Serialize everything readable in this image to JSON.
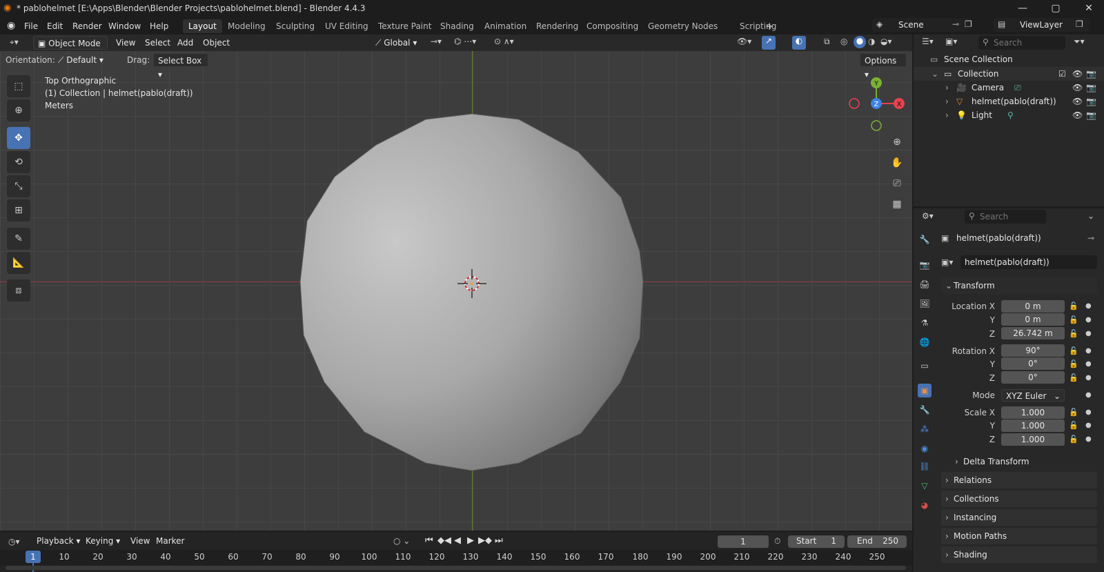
{
  "window": {
    "title": "* pablohelmet [E:\\Apps\\Blender\\Blender Projects\\pablohelmet.blend] - Blender 4.4.3"
  },
  "menu": [
    "File",
    "Edit",
    "Render",
    "Window",
    "Help"
  ],
  "workspaces": [
    "Layout",
    "Modeling",
    "Sculpting",
    "UV Editing",
    "Texture Paint",
    "Shading",
    "Animation",
    "Rendering",
    "Compositing",
    "Geometry Nodes",
    "Scripting"
  ],
  "scene": {
    "name": "Scene",
    "view_layer": "ViewLayer"
  },
  "viewport": {
    "mode": "Object Mode",
    "menus": [
      "View",
      "Select",
      "Add",
      "Object"
    ],
    "orientation_label": "Orientation:",
    "orientation": "Default",
    "drag_label": "Drag:",
    "drag": "Select Box",
    "transform_space": "Global",
    "options": "Options",
    "overlay_title": "Top Orthographic",
    "overlay_collection": "(1) Collection | helmet(pablo(draft))",
    "overlay_units": "Meters",
    "gizmo": {
      "x": "X",
      "y": "Y",
      "z": "Z"
    }
  },
  "outliner": {
    "search_placeholder": "Search",
    "root": "Scene Collection",
    "collection": "Collection",
    "items": [
      "Camera",
      "helmet(pablo(draft))",
      "Light"
    ]
  },
  "properties": {
    "search_placeholder": "Search",
    "object_name": "helmet(pablo(draft))",
    "datablock": "helmet(pablo(draft))",
    "transform_label": "Transform",
    "location_label": "Location X",
    "rotation_label": "Rotation X",
    "scale_label": "Scale X",
    "axis_y": "Y",
    "axis_z": "Z",
    "location": [
      "0 m",
      "0 m",
      "26.742 m"
    ],
    "rotation": [
      "90°",
      "0°",
      "0°"
    ],
    "mode_label": "Mode",
    "mode": "XYZ Euler",
    "scale": [
      "1.000",
      "1.000",
      "1.000"
    ],
    "panels": [
      "Delta Transform",
      "Relations",
      "Collections",
      "Instancing",
      "Motion Paths",
      "Shading"
    ]
  },
  "timeline": {
    "menus": [
      "Playback",
      "Keying",
      "View",
      "Marker"
    ],
    "current_frame": "1",
    "start_label": "Start",
    "start": "1",
    "end_label": "End",
    "end": "250",
    "ticks": [
      "1",
      "10",
      "20",
      "30",
      "40",
      "50",
      "60",
      "70",
      "80",
      "90",
      "100",
      "110",
      "120",
      "130",
      "140",
      "150",
      "160",
      "170",
      "180",
      "190",
      "200",
      "210",
      "220",
      "230",
      "240",
      "250"
    ]
  },
  "colors": {
    "accent": "#4772b3",
    "x_axis": "#e8414f",
    "y_axis": "#7ab135",
    "z_axis": "#3b83e6"
  }
}
